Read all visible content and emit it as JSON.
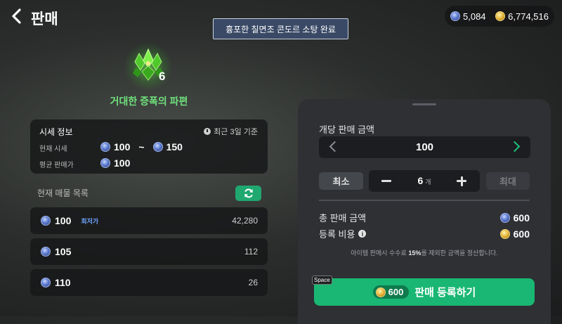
{
  "header": {
    "title": "판매",
    "toast": "흉포한 칠면조 콘도르 소탕 완료"
  },
  "currency": {
    "blue_amount": "5,084",
    "gold_amount": "6,774,516"
  },
  "item": {
    "count": "6",
    "name": "거대한 증폭의 파편"
  },
  "market_info": {
    "title": "시세 정보",
    "basis": "최근 3일 기준",
    "current_label": "현재 시세",
    "current_min": "100",
    "range_sep": "~",
    "current_max": "150",
    "avg_label": "평균 판매가",
    "avg_value": "100"
  },
  "listings": {
    "title": "현재 매물 목록",
    "items": [
      {
        "price": "100",
        "tag": "최저가",
        "quantity": "42,280"
      },
      {
        "price": "105",
        "quantity": "112"
      },
      {
        "price": "110",
        "quantity": "26"
      }
    ]
  },
  "sell_panel": {
    "unit_price_label": "개당 판매 금액",
    "unit_price": "100",
    "min_label": "최소",
    "quantity": "6",
    "quantity_unit": "개",
    "max_label": "최대",
    "total_label": "총 판매 금액",
    "total_value": "600",
    "fee_label": "등록 비용",
    "fee_value": "600",
    "notice_pre": "아이템 판매시 수수료 ",
    "notice_pct": "15%",
    "notice_post": "를 제외한 금액을 정산합니다.",
    "space_key": "Space",
    "submit_cost": "600",
    "submit_label": "판매 등록하기"
  },
  "colors": {
    "accent_green": "#19b773",
    "item_name": "#6fe07c",
    "lowest_tag": "#6fa4ff"
  }
}
